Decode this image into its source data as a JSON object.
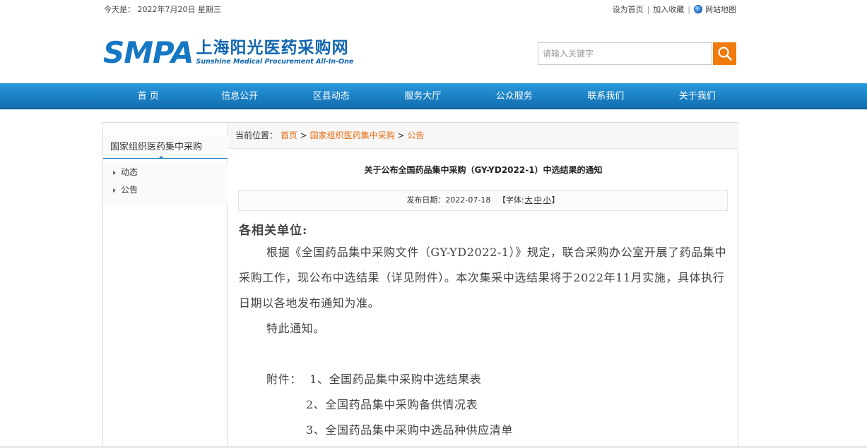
{
  "topbar": {
    "today": "今天是： 2022年7月20日 星期三",
    "links": [
      "设为首页",
      "加入收藏"
    ],
    "sitemap": "网站地图"
  },
  "logo": {
    "mark": "SMPA",
    "cn": "上海阳光医药采购网",
    "en": "Sunshine Medical Procurement All-In-One"
  },
  "search": {
    "placeholder": "请输入关键字",
    "icon": "search-icon"
  },
  "nav": [
    "首 页",
    "信息公开",
    "区县动态",
    "服务大厅",
    "公众服务",
    "联系我们",
    "关于我们"
  ],
  "sidebar": {
    "title": "国家组织医药集中采购",
    "items": [
      "动态",
      "公告"
    ]
  },
  "breadcrumb": {
    "label": "当前位置：",
    "items": [
      "首页",
      "国家组织医药集中采购",
      "公告"
    ],
    "sep": ">"
  },
  "article": {
    "title": "关于公布全国药品集中采购（GY-YD2022-1）中选结果的通知",
    "date": "发布日期：2022-07-18",
    "font_open": "【字体:",
    "font_sizes": [
      "大",
      "中",
      "小"
    ],
    "font_close": "】",
    "greeting": "各相关单位:",
    "para1": "根据《全国药品集中采购文件（GY-YD2022-1）》规定，联合采购办公室开展了药品集中采购工作，现公布中选结果（详见附件）。本次集采中选结果将于2022年11月实施，具体执行日期以各地发布通知为准。",
    "para2": "特此通知。",
    "attachments_label": "附件：",
    "attachments": [
      "1、全国药品集中采购中选结果表",
      "2、全国药品集中采购备供情况表",
      "3、全国药品集中采购中选品种供应清单"
    ]
  },
  "colors": {
    "brand": "#1677c4",
    "nav": "#1b80c4",
    "accent": "#f07a0c",
    "link": "#e56b0e"
  }
}
